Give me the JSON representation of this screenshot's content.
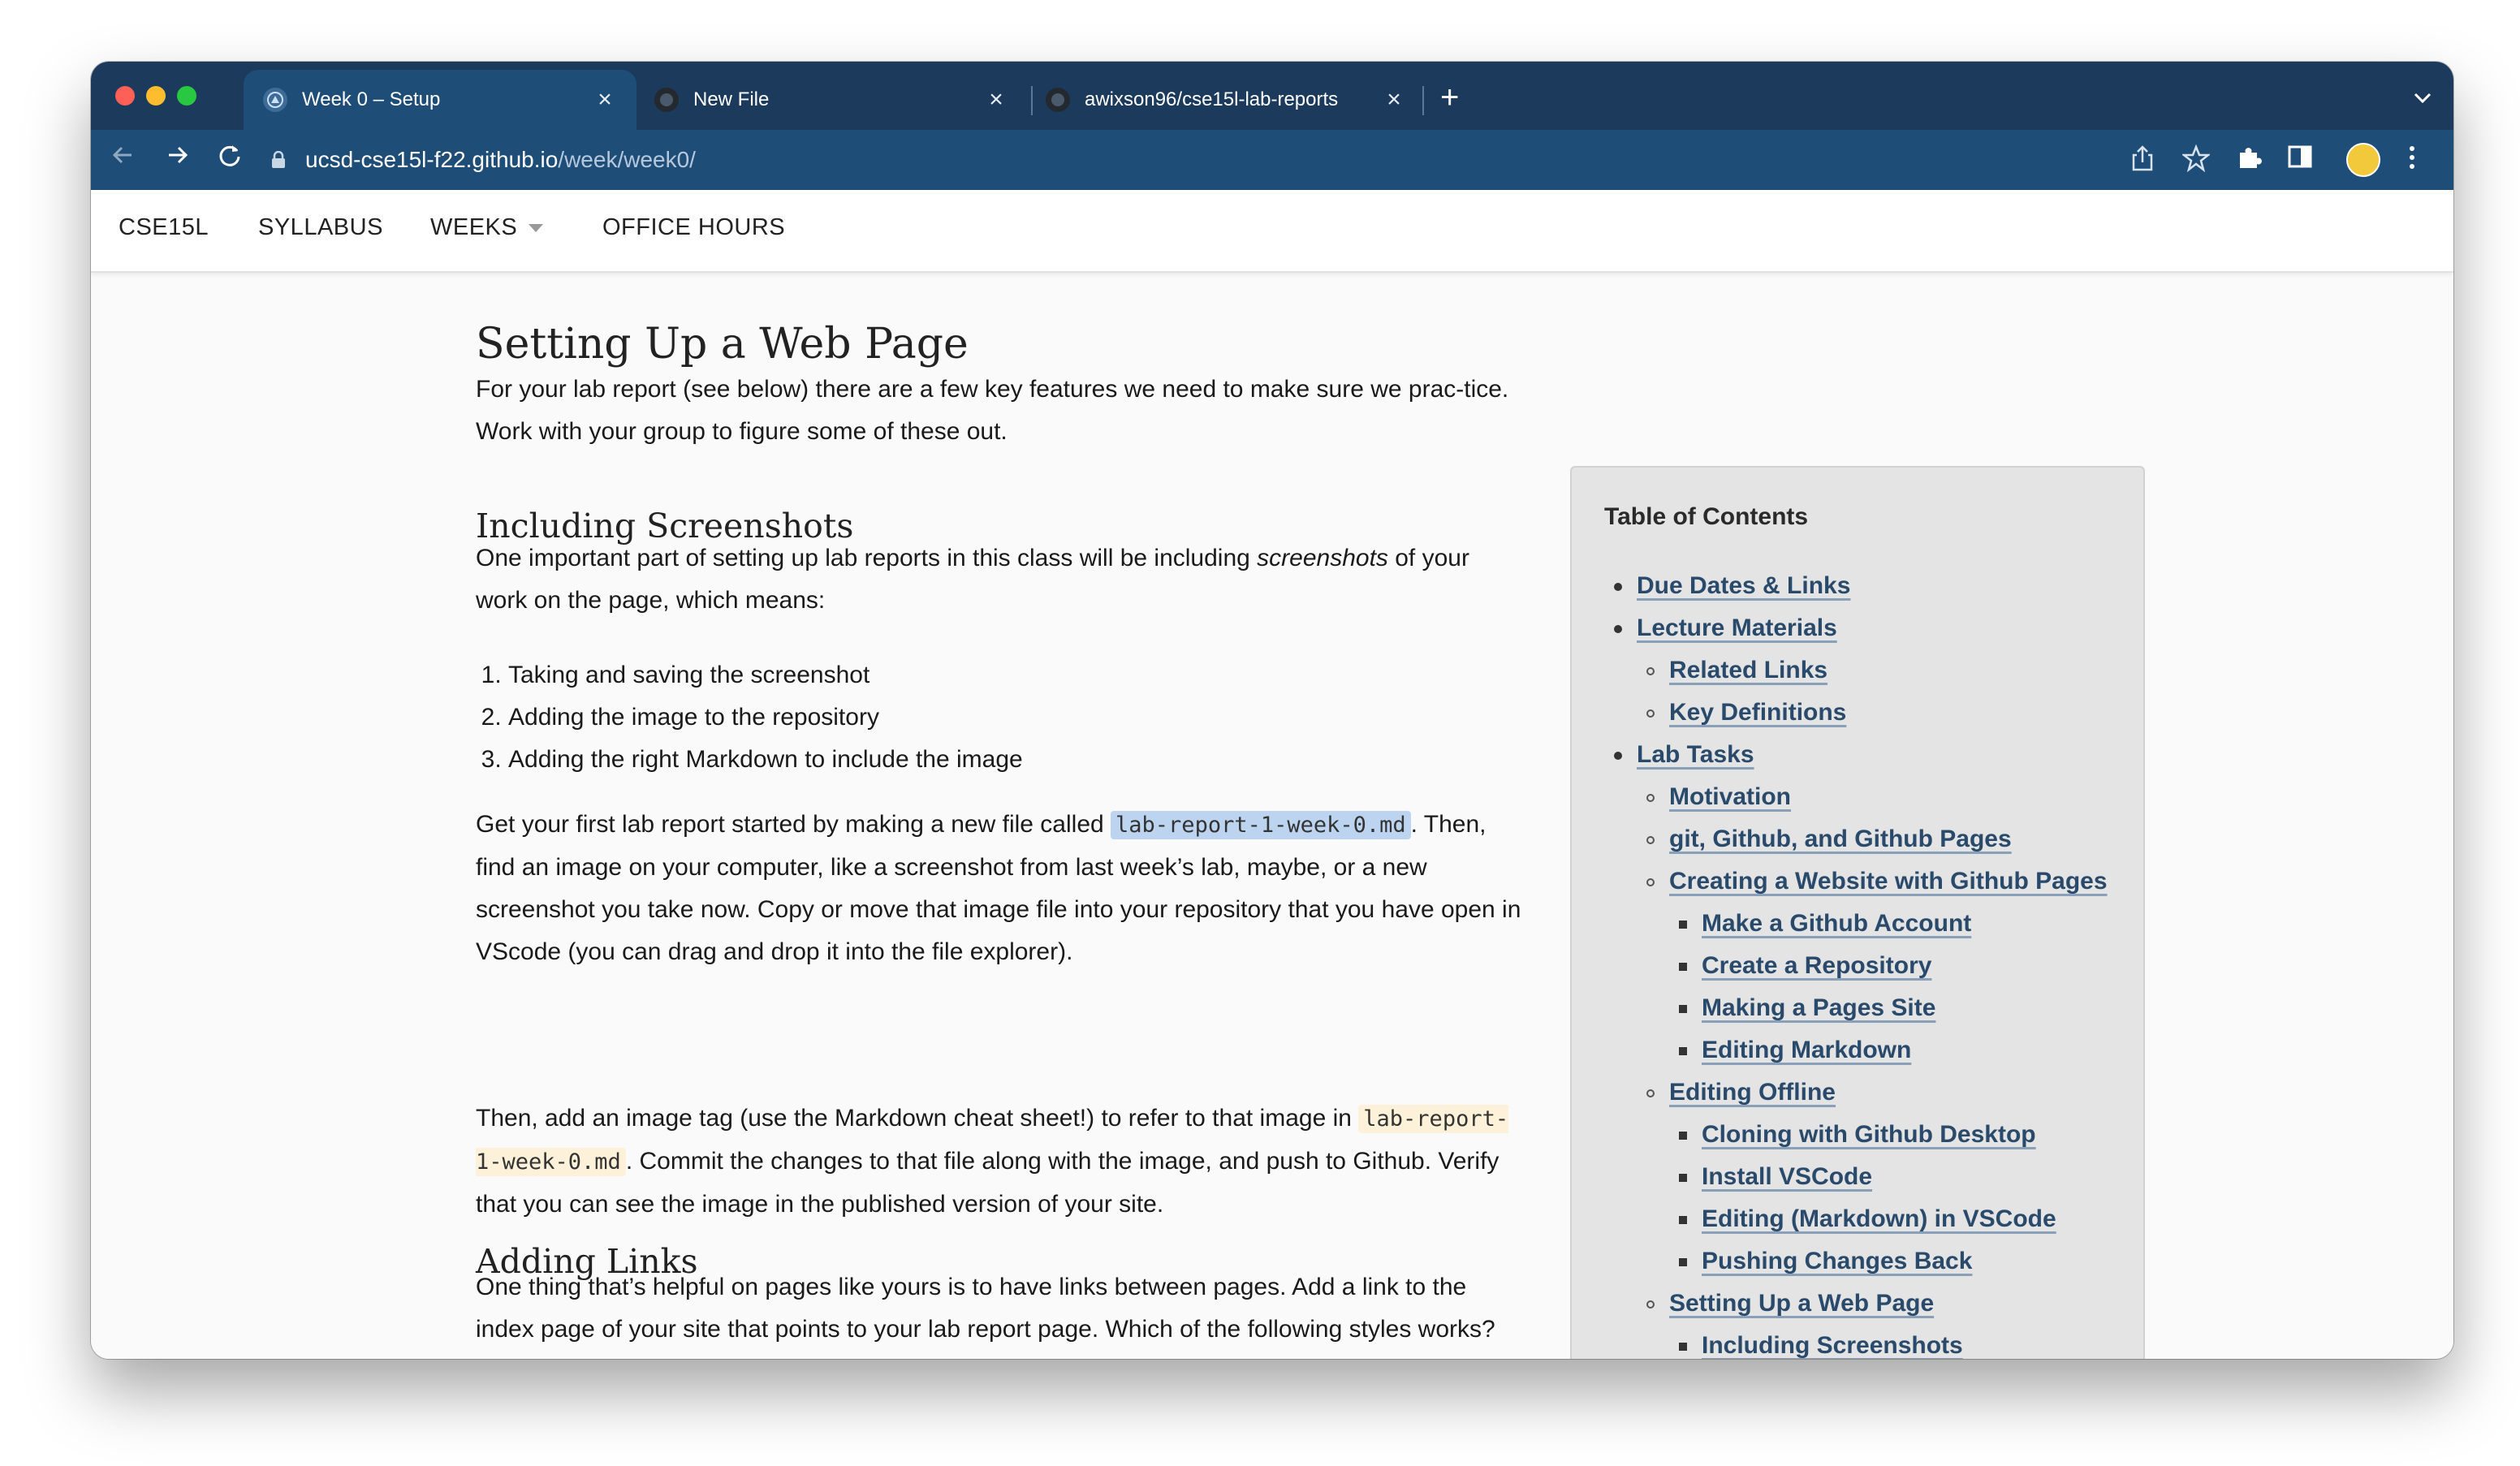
{
  "browser": {
    "tabs": [
      {
        "label": "Week 0 – Setup",
        "active": true
      },
      {
        "label": "New File",
        "active": false
      },
      {
        "label": "awixson96/cse15l-lab-reports",
        "active": false
      }
    ],
    "url_host": "ucsd-cse15l-f22.github.io",
    "url_path": "/week/week0/"
  },
  "site_nav": {
    "items": [
      "CSE15L",
      "SYLLABUS",
      "WEEKS",
      "OFFICE HOURS"
    ]
  },
  "main": {
    "h_setup": "Setting Up a Web Page",
    "p_intro": "For your lab report (see below) there are a few key features we need to make sure we prac-tice. Work with your group to figure some of these out.",
    "h_screenshots": "Including Screenshots",
    "p_screens_before": "One important part of setting up lab reports in this class will be including ",
    "p_screens_em": "screenshots",
    "p_screens_after": " of your work on the page, which means:",
    "steps": [
      "Taking and saving the screenshot",
      "Adding the image to the repository",
      "Adding the right Markdown to include the image"
    ],
    "p_first_before": "Get your first lab report started by making a new file called ",
    "p_first_code": "lab-report-1-week-0.md",
    "p_first_after": ". Then, find an image on your computer, like a screenshot from last week’s lab, maybe, or a new screenshot you take now. Copy or move that image file into your repository that you have open in VScode (you can drag and drop it into the file explorer).",
    "p_tag_before": "Then, add an image tag (use the Markdown cheat sheet!) to refer to that image in ",
    "p_tag_code": "lab-report-1-week-0.md",
    "p_tag_after": ". Commit the changes to that file along with the image, and push to Github. Verify that you can see the image in the published version of your site.",
    "h_links": "Adding Links",
    "p_links": "One thing that’s helpful on pages like yours is to have links between pages. Add a link to the index page of your site that points to your lab report page. Which of the following styles works?"
  },
  "toc": {
    "title": "Table of Contents",
    "items": [
      {
        "label": "Due Dates & Links",
        "level": 1
      },
      {
        "label": "Lecture Materials",
        "level": 1
      },
      {
        "label": "Related Links",
        "level": 2
      },
      {
        "label": "Key Definitions",
        "level": 2
      },
      {
        "label": "Lab Tasks",
        "level": 1
      },
      {
        "label": "Motivation",
        "level": 2
      },
      {
        "label": "git, Github, and Github Pages",
        "level": 2
      },
      {
        "label": "Creating a Website with Github Pages",
        "level": 2
      },
      {
        "label": "Make a Github Account",
        "level": 3
      },
      {
        "label": "Create a Repository",
        "level": 3
      },
      {
        "label": "Making a Pages Site",
        "level": 3
      },
      {
        "label": "Editing Markdown",
        "level": 3
      },
      {
        "label": "Editing Offline",
        "level": 2
      },
      {
        "label": "Cloning with Github Desktop",
        "level": 3
      },
      {
        "label": "Install VSCode",
        "level": 3
      },
      {
        "label": "Editing (Markdown) in VSCode",
        "level": 3
      },
      {
        "label": "Pushing Changes Back",
        "level": 3
      },
      {
        "label": "Setting Up a Web Page",
        "level": 2
      },
      {
        "label": "Including Screenshots",
        "level": 3
      }
    ]
  },
  "colors": {
    "tabstrip": "#1b3a5c",
    "toolbar": "#1e4d78",
    "link": "#2a4a6c",
    "toc_bg": "#e4e4e4"
  },
  "icons": [
    "back-arrow-icon",
    "forward-arrow-icon",
    "reload-icon",
    "lock-icon",
    "share-icon",
    "star-icon",
    "extensions-icon",
    "sidepanel-icon",
    "profile-avatar",
    "kebab-menu-icon",
    "tab-search-icon",
    "new-tab-icon",
    "close-icon"
  ]
}
